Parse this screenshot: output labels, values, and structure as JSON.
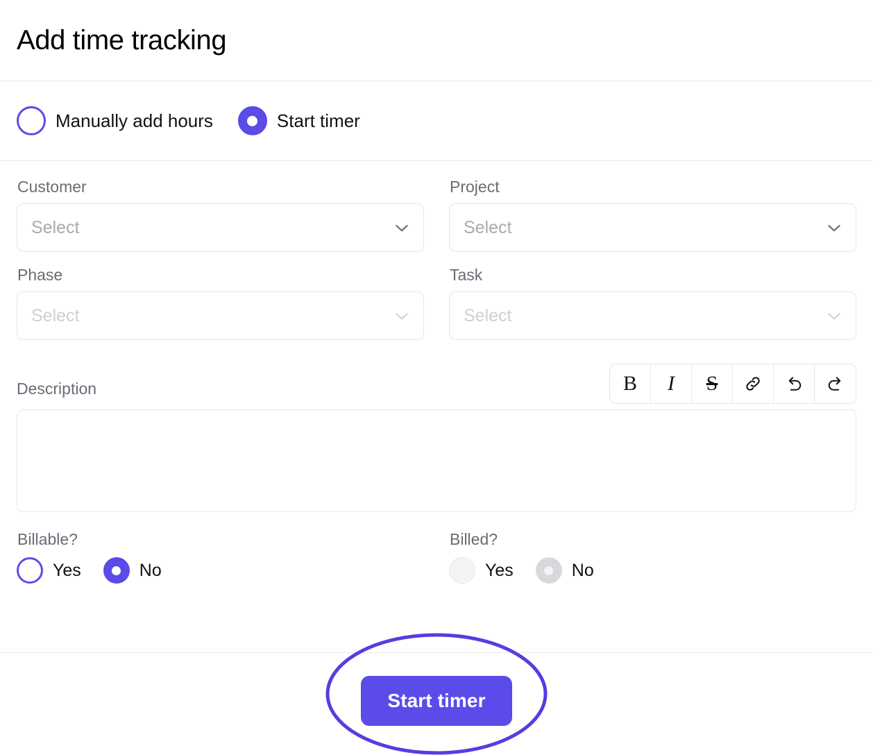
{
  "header": {
    "title": "Add time tracking"
  },
  "mode": {
    "options": [
      {
        "label": "Manually add hours",
        "selected": false
      },
      {
        "label": "Start timer",
        "selected": true
      }
    ]
  },
  "fields": {
    "customer": {
      "label": "Customer",
      "placeholder": "Select",
      "value": "",
      "disabled": false
    },
    "project": {
      "label": "Project",
      "placeholder": "Select",
      "value": "",
      "disabled": false
    },
    "phase": {
      "label": "Phase",
      "placeholder": "Select",
      "value": "",
      "disabled": true
    },
    "task": {
      "label": "Task",
      "placeholder": "Select",
      "value": "",
      "disabled": true
    }
  },
  "description": {
    "label": "Description",
    "value": "",
    "toolbar": [
      {
        "name": "bold-icon",
        "glyph": "B"
      },
      {
        "name": "italic-icon",
        "glyph": "I"
      },
      {
        "name": "strikethrough-icon",
        "glyph": "S"
      },
      {
        "name": "link-icon",
        "glyph": ""
      },
      {
        "name": "undo-icon",
        "glyph": ""
      },
      {
        "name": "redo-icon",
        "glyph": ""
      }
    ]
  },
  "billable": {
    "label": "Billable?",
    "options": [
      {
        "label": "Yes",
        "selected": false
      },
      {
        "label": "No",
        "selected": true
      }
    ]
  },
  "billed": {
    "label": "Billed?",
    "disabled": true,
    "options": [
      {
        "label": "Yes",
        "selected": false
      },
      {
        "label": "No",
        "selected": true
      }
    ]
  },
  "footer": {
    "submit_label": "Start timer"
  },
  "colors": {
    "accent": "#5B4BE8",
    "annotation": "#5B3BE0",
    "label_text": "#6A6B75",
    "placeholder": "#A9A9B0",
    "placeholder_disabled": "#CFCFD4",
    "border": "#E6E6E9",
    "divider": "#E8E8EA"
  }
}
